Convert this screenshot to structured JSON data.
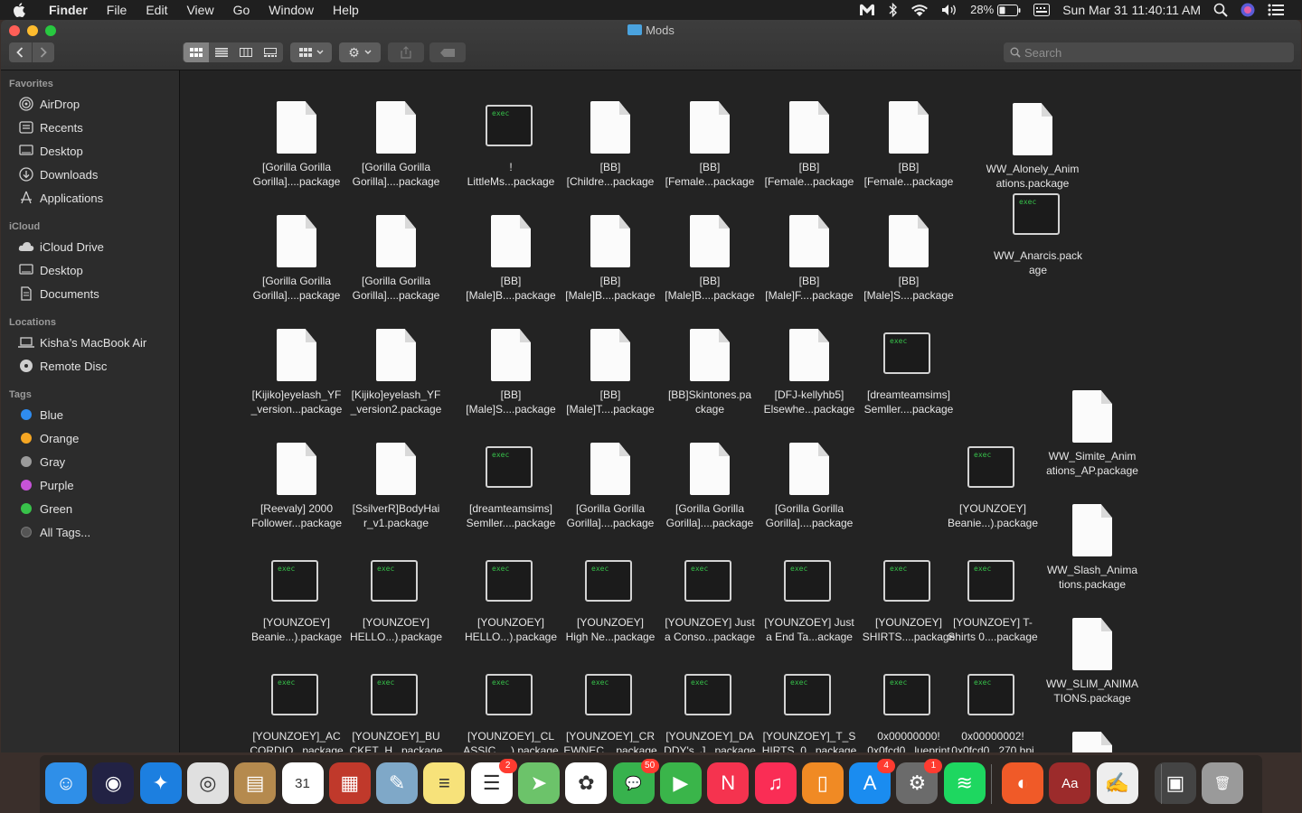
{
  "menubar": {
    "app": "Finder",
    "menus": [
      "File",
      "Edit",
      "View",
      "Go",
      "Window",
      "Help"
    ],
    "battery": "28%",
    "datetime": "Sun Mar 31  11:40:11 AM"
  },
  "window": {
    "title": "Mods",
    "search_placeholder": "Search"
  },
  "sidebar": {
    "favorites_header": "Favorites",
    "favorites": [
      {
        "label": "AirDrop",
        "icon": "airdrop-icon"
      },
      {
        "label": "Recents",
        "icon": "recents-icon"
      },
      {
        "label": "Desktop",
        "icon": "desktop-icon"
      },
      {
        "label": "Downloads",
        "icon": "downloads-icon"
      },
      {
        "label": "Applications",
        "icon": "applications-icon"
      }
    ],
    "icloud_header": "iCloud",
    "icloud": [
      {
        "label": "iCloud Drive",
        "icon": "cloud-icon"
      },
      {
        "label": "Desktop",
        "icon": "desktop-icon"
      },
      {
        "label": "Documents",
        "icon": "document-icon"
      }
    ],
    "locations_header": "Locations",
    "locations": [
      {
        "label": "Kisha’s MacBook Air",
        "icon": "laptop-icon"
      },
      {
        "label": "Remote Disc",
        "icon": "disc-icon"
      }
    ],
    "tags_header": "Tags",
    "tags": [
      {
        "label": "Blue",
        "color": "#2f8cf0"
      },
      {
        "label": "Orange",
        "color": "#f5a623"
      },
      {
        "label": "Gray",
        "color": "#9b9b9b"
      },
      {
        "label": "Purple",
        "color": "#c653d8"
      },
      {
        "label": "Green",
        "color": "#38c24a"
      },
      {
        "label": "All Tags...",
        "color": "#555555"
      }
    ]
  },
  "files": [
    {
      "type": "doc",
      "line1": "[Gorilla Gorilla",
      "line2": "Gorilla]....package"
    },
    {
      "type": "doc",
      "line1": "[Gorilla Gorilla",
      "line2": "Gorilla]....package"
    },
    {
      "type": "exec",
      "line1": "!",
      "line2": "LittleMs...package"
    },
    {
      "type": "doc",
      "line1": "[BB]",
      "line2": "[Childre...package"
    },
    {
      "type": "doc",
      "line1": "[BB]",
      "line2": "[Female...package"
    },
    {
      "type": "doc",
      "line1": "[BB]",
      "line2": "[Female...package"
    },
    {
      "type": "doc",
      "line1": "[BB]",
      "line2": "[Female...package"
    },
    {
      "type": "doc",
      "line1": "WW_Alonely_Anim",
      "line2": "ations.package"
    },
    {
      "type": "doc",
      "line1": "[Gorilla Gorilla",
      "line2": "Gorilla]....package"
    },
    {
      "type": "doc",
      "line1": "[Gorilla Gorilla",
      "line2": "Gorilla]....package"
    },
    {
      "type": "doc",
      "line1": "[BB]",
      "line2": "[Male]B....package"
    },
    {
      "type": "doc",
      "line1": "[BB]",
      "line2": "[Male]B....package"
    },
    {
      "type": "doc",
      "line1": "[BB]",
      "line2": "[Male]B....package"
    },
    {
      "type": "doc",
      "line1": "[BB]",
      "line2": "[Male]F....package"
    },
    {
      "type": "doc",
      "line1": "[BB]",
      "line2": "[Male]S....package"
    },
    {
      "type": "exec",
      "line1": "WW_Anarcis.pack",
      "line2": "age"
    },
    {
      "type": "doc",
      "line1": "[Kijiko]eyelash_YF",
      "line2": "_version...package"
    },
    {
      "type": "doc",
      "line1": "[Kijiko]eyelash_YF",
      "line2": "_version2.package"
    },
    {
      "type": "doc",
      "line1": "[BB]",
      "line2": "[Male]S....package"
    },
    {
      "type": "doc",
      "line1": "[BB]",
      "line2": "[Male]T....package"
    },
    {
      "type": "doc",
      "line1": "[BB]Skintones.pa",
      "line2": "ckage"
    },
    {
      "type": "doc",
      "line1": "[DFJ-kellyhb5]",
      "line2": "Elsewhe...package"
    },
    {
      "type": "exec",
      "line1": "[dreamteamsims]",
      "line2": "Semller....package"
    },
    {
      "type": "doc",
      "line1": "WW_Simite_Anim",
      "line2": "ations_AP.package"
    },
    {
      "type": "doc",
      "line1": "[Reevaly] 2000",
      "line2": "Follower...package"
    },
    {
      "type": "doc",
      "line1": "[SsilverR]BodyHai",
      "line2": "r_v1.package"
    },
    {
      "type": "exec",
      "line1": "[dreamteamsims]",
      "line2": "Semller....package"
    },
    {
      "type": "doc",
      "line1": "[Gorilla Gorilla",
      "line2": "Gorilla]....package"
    },
    {
      "type": "doc",
      "line1": "[Gorilla Gorilla",
      "line2": "Gorilla]....package"
    },
    {
      "type": "doc",
      "line1": "[Gorilla Gorilla",
      "line2": "Gorilla]....package"
    },
    {
      "type": "exec",
      "line1": "[YOUNZOEY]",
      "line2": "Beanie...).package"
    },
    {
      "type": "doc",
      "line1": "WW_Slash_Anima",
      "line2": "tions.package"
    },
    {
      "type": "exec",
      "line1": "[YOUNZOEY]",
      "line2": "Beanie...).package"
    },
    {
      "type": "exec",
      "line1": "[YOUNZOEY]",
      "line2": "HELLO...).package"
    },
    {
      "type": "exec",
      "line1": "[YOUNZOEY]",
      "line2": "HELLO...).package"
    },
    {
      "type": "exec",
      "line1": "[YOUNZOEY]",
      "line2": "High Ne...package"
    },
    {
      "type": "exec",
      "line1": "[YOUNZOEY] Just",
      "line2": "a Conso...package"
    },
    {
      "type": "exec",
      "line1": "[YOUNZOEY] Just",
      "line2": "a End Ta...ackage"
    },
    {
      "type": "exec",
      "line1": "[YOUNZOEY]",
      "line2": "SHIRTS....package"
    },
    {
      "type": "exec",
      "line1": "[YOUNZOEY] T-",
      "line2": "Shirts 0....package"
    },
    {
      "type": "doc",
      "line1": "WW_SLIM_ANIMA",
      "line2": "TIONS.package"
    },
    {
      "type": "exec",
      "line1": "[YOUNZOEY]_AC",
      "line2": "CORDIO...package"
    },
    {
      "type": "exec",
      "line1": "[YOUNZOEY]_BU",
      "line2": "CKET_H...package"
    },
    {
      "type": "exec",
      "line1": "[YOUNZOEY]_CL",
      "line2": "ASSIC_...).package"
    },
    {
      "type": "exec",
      "line1": "[YOUNZOEY]_CR",
      "line2": "EWNEC....package"
    },
    {
      "type": "exec",
      "line1": "[YOUNZOEY]_DA",
      "line2": "DDY's_J...package"
    },
    {
      "type": "exec",
      "line1": "[YOUNZOEY]_T_S",
      "line2": "HIRTS_0...package"
    },
    {
      "type": "exec",
      "line1": "0x00000000!",
      "line2": "0x0fcd0...lueprint"
    },
    {
      "type": "exec",
      "line1": "0x00000002!",
      "line2": "0x0fcd0...270.bpi"
    },
    {
      "type": "doc",
      "line1": "",
      "line2": ""
    }
  ],
  "exec_label": "exec",
  "dock": [
    {
      "name": "finder",
      "color": "#2f8fe8",
      "glyph": "☺"
    },
    {
      "name": "siri",
      "color": "#222244",
      "glyph": "◉"
    },
    {
      "name": "safari",
      "color": "#1c7fe0",
      "glyph": "✦"
    },
    {
      "name": "chrome",
      "color": "#e0e0e0",
      "glyph": "◎"
    },
    {
      "name": "contacts",
      "color": "#b58a4e",
      "glyph": "▤"
    },
    {
      "name": "calendar",
      "color": "#ffffff",
      "glyph": "31"
    },
    {
      "name": "photo-booth",
      "color": "#c0392b",
      "glyph": "▦"
    },
    {
      "name": "preview",
      "color": "#7fa8c8",
      "glyph": "✎"
    },
    {
      "name": "notes",
      "color": "#f7e27a",
      "glyph": "≡"
    },
    {
      "name": "reminders",
      "color": "#ffffff",
      "glyph": "☰",
      "badge": "2"
    },
    {
      "name": "maps",
      "color": "#6cc36a",
      "glyph": "➤"
    },
    {
      "name": "photos",
      "color": "#ffffff",
      "glyph": "✿"
    },
    {
      "name": "messages",
      "color": "#37b24d",
      "glyph": "💬",
      "badge": "50"
    },
    {
      "name": "facetime",
      "color": "#3ab54a",
      "glyph": "▶"
    },
    {
      "name": "news",
      "color": "#f5334f",
      "glyph": "N"
    },
    {
      "name": "music",
      "color": "#fa2d55",
      "glyph": "♫"
    },
    {
      "name": "books",
      "color": "#f08a24",
      "glyph": "▯"
    },
    {
      "name": "app-store",
      "color": "#1a8cf0",
      "glyph": "A",
      "badge": "4"
    },
    {
      "name": "system-preferences",
      "color": "#6b6b6b",
      "glyph": "⚙",
      "badge": "1"
    },
    {
      "name": "spotify",
      "color": "#1ed760",
      "glyph": "≋"
    },
    {
      "name": "mediahuman",
      "color": "#f05a28",
      "glyph": "◐"
    },
    {
      "name": "dictionary",
      "color": "#9c2b2b",
      "glyph": "Aa"
    },
    {
      "name": "textedit",
      "color": "#eeeeee",
      "glyph": "✍"
    },
    {
      "name": "photo-thumbnail",
      "color": "#444444",
      "glyph": "▣"
    },
    {
      "name": "trash",
      "color": "#9a9a9a",
      "glyph": "🗑"
    }
  ]
}
